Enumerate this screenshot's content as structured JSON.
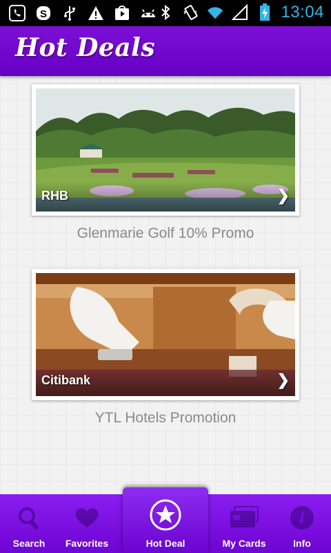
{
  "status_bar": {
    "time": "13:04",
    "left_icons": [
      "viber-icon",
      "skype-icon",
      "usb-icon",
      "warning-icon",
      "play-store-icon",
      "android-icon"
    ],
    "right_icons": [
      "bluetooth-icon",
      "vibrate-icon",
      "wifi-icon",
      "signal-icon",
      "battery-charging-icon"
    ]
  },
  "header": {
    "title": "Hot Deals"
  },
  "deals": [
    {
      "bank": "RHB",
      "caption": "Glenmarie Golf 10% Promo",
      "image": "golf-course-photo"
    },
    {
      "bank": "Citibank",
      "caption": "YTL Hotels Promotion",
      "image": "luggage-gloves-photo"
    }
  ],
  "tabs": [
    {
      "label": "Search",
      "icon": "search-icon"
    },
    {
      "label": "Favorites",
      "icon": "heart-icon"
    },
    {
      "label": "Hot Deal",
      "icon": "star-icon",
      "active": true
    },
    {
      "label": "My Cards",
      "icon": "card-icon"
    },
    {
      "label": "Info",
      "icon": "info-icon"
    }
  ],
  "colors": {
    "brand": "#7000cc",
    "clock": "#33b5e5",
    "caption": "#8a8a8a"
  }
}
